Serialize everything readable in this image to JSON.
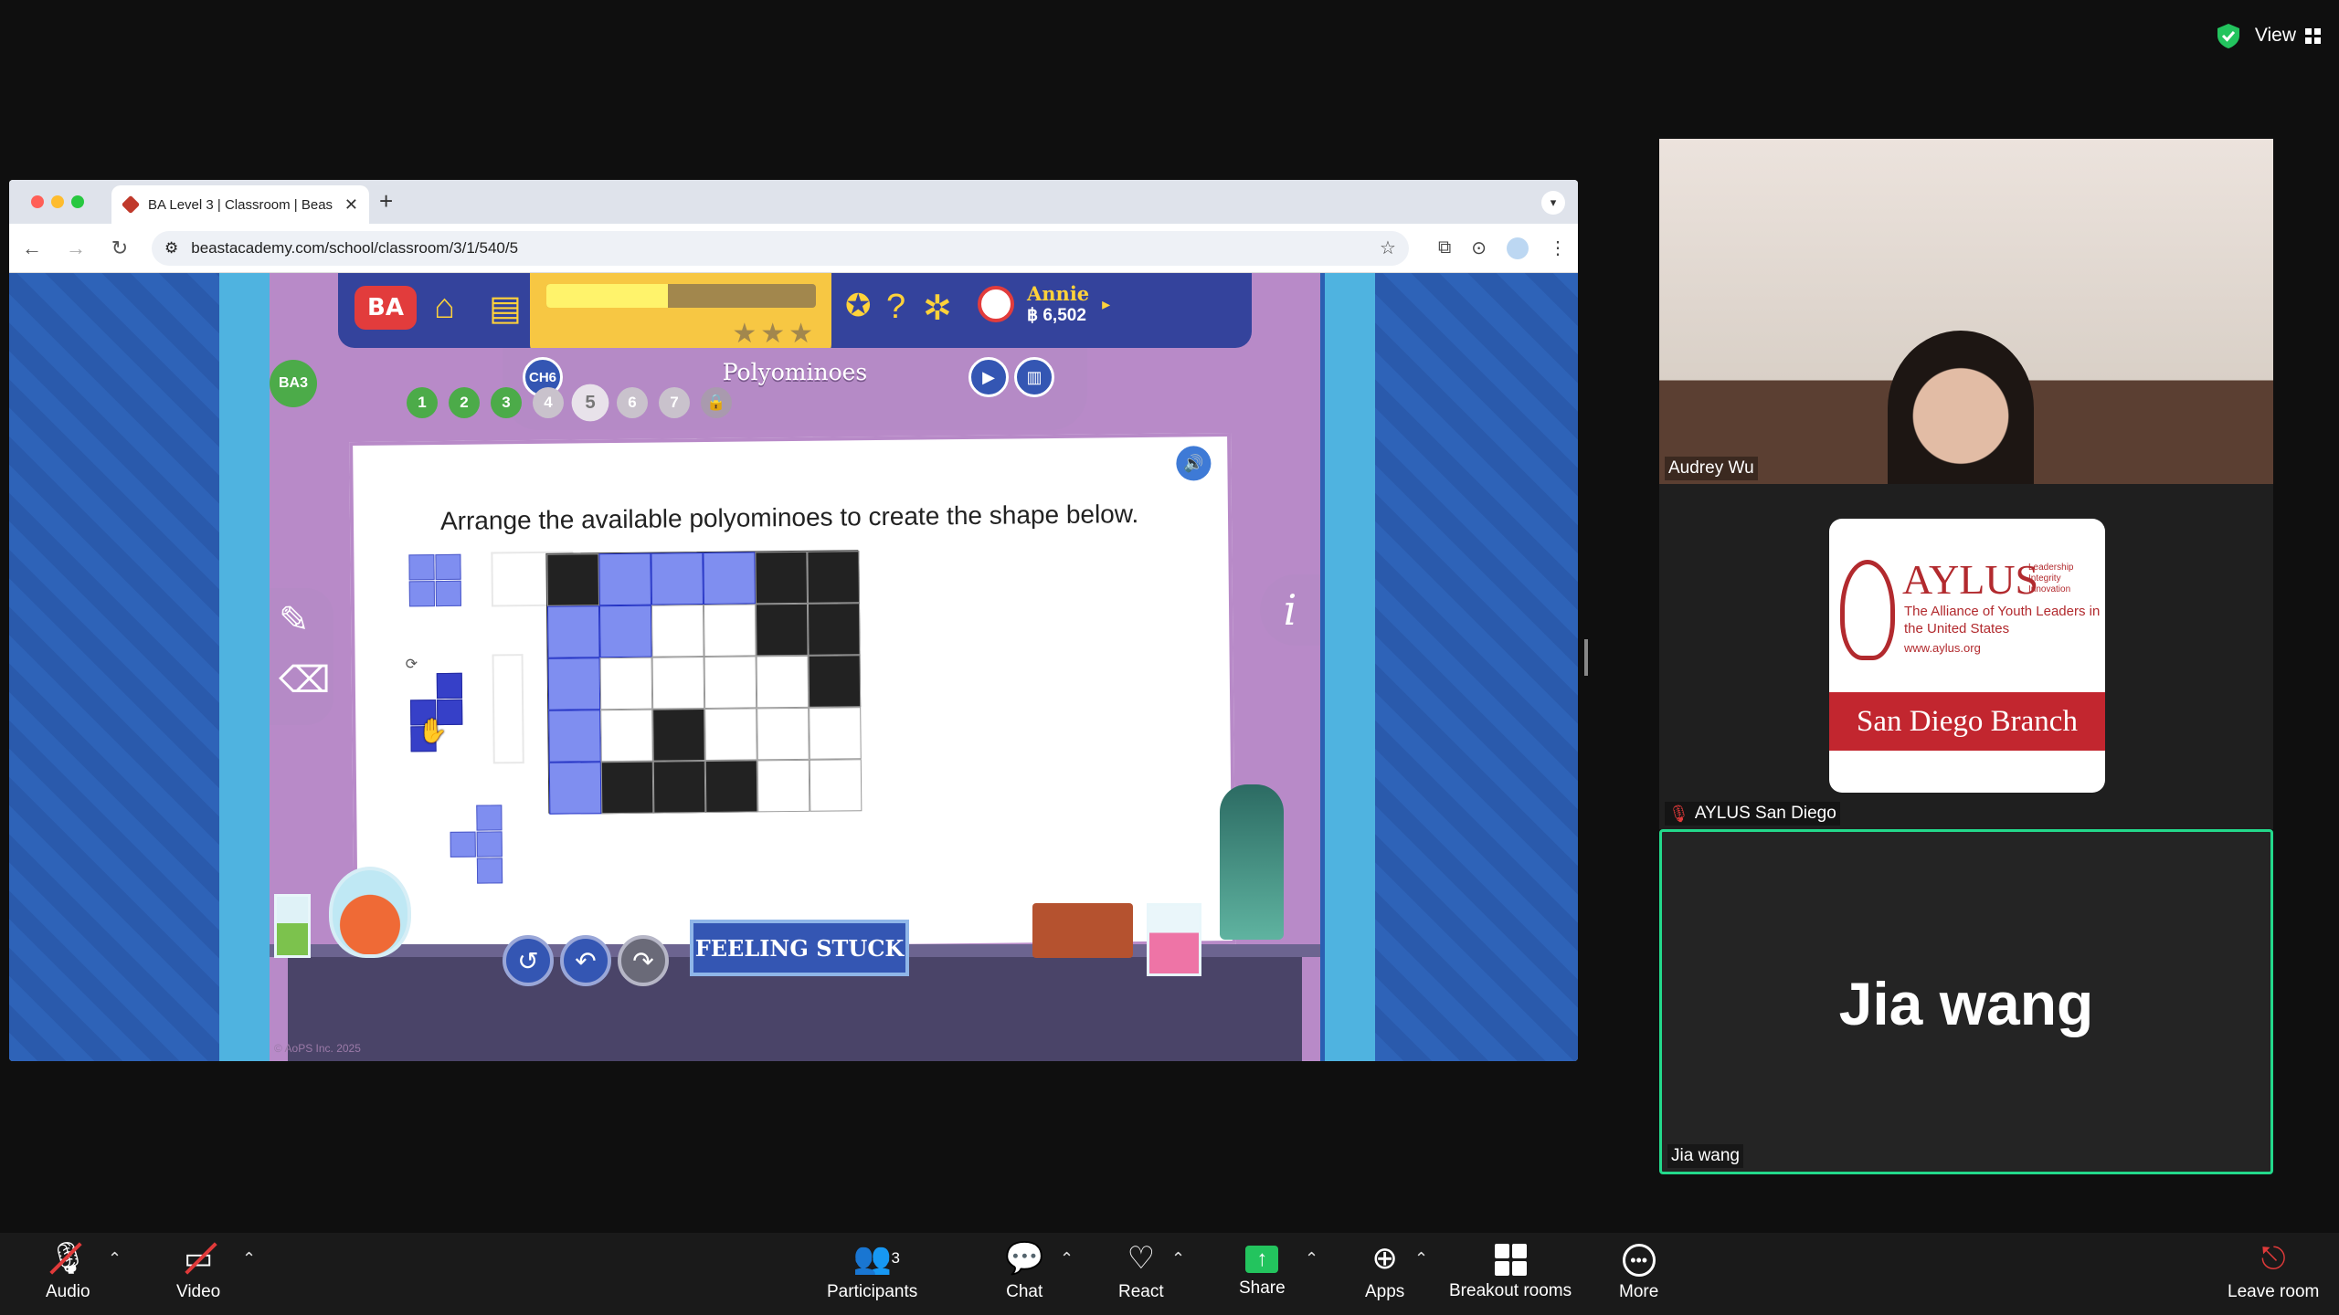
{
  "top_right": {
    "view_label": "View"
  },
  "browser": {
    "tab_title": "BA Level 3 | Classroom | Beas",
    "url": "beastacademy.com/school/classroom/3/1/540/5",
    "traffic_colors": [
      "#ff5f57",
      "#febc2e",
      "#28c840"
    ]
  },
  "game": {
    "logo": "BA",
    "user_name": "Annie",
    "user_coins": "฿ 6,502",
    "progress": 0.45,
    "chapter_badge": "CH6",
    "lesson_title": "Polyominoes",
    "problems": [
      {
        "n": "1",
        "state": "done"
      },
      {
        "n": "2",
        "state": "done"
      },
      {
        "n": "3",
        "state": "done"
      },
      {
        "n": "4",
        "state": "todo"
      },
      {
        "n": "5",
        "state": "current"
      },
      {
        "n": "6",
        "state": "todo"
      },
      {
        "n": "7",
        "state": "todo"
      },
      {
        "n": "8",
        "state": "locked"
      }
    ],
    "ba3_badge": "BA3",
    "instruction": "Arrange the available polyominoes to create the shape below.",
    "feeling_stuck": "FEELING STUCK",
    "info": "i",
    "copyright": "© AoPS Inc. 2025",
    "colors": {
      "filled": "#7f8ef0",
      "black": "#222222",
      "white": "#ffffff"
    }
  },
  "participants": [
    {
      "name": "Audrey Wu"
    },
    {
      "name": "AYLUS San Diego",
      "muted": true,
      "logo": {
        "word": "AYLUS",
        "tagline": "Leadership Integrity Innovation",
        "subtitle": "The Alliance of Youth Leaders in the United States",
        "url": "www.aylus.org",
        "branch": "San Diego Branch"
      }
    },
    {
      "name": "Jia wang",
      "active_speaker": true
    }
  ],
  "toolbar": {
    "audio": "Audio",
    "video": "Video",
    "participants": "Participants",
    "participants_count": "3",
    "chat": "Chat",
    "react": "React",
    "share": "Share",
    "apps": "Apps",
    "breakout": "Breakout rooms",
    "more": "More",
    "leave": "Leave room"
  }
}
